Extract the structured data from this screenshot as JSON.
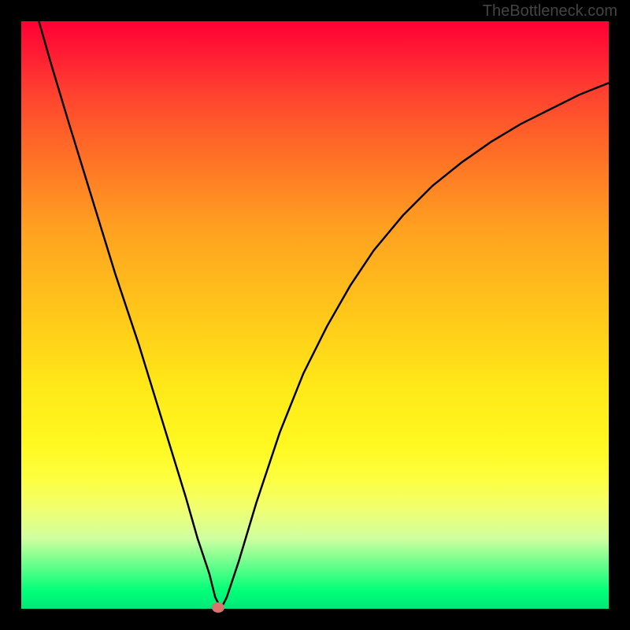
{
  "watermark": "TheBottleneck.com",
  "chart_data": {
    "type": "line",
    "title": "",
    "xlabel": "",
    "ylabel": "",
    "xlim": [
      0,
      100
    ],
    "ylim": [
      0,
      100
    ],
    "series": [
      {
        "name": "curve",
        "x": [
          3,
          5,
          8,
          12,
          16,
          20,
          24,
          28,
          30,
          32,
          33,
          34,
          35,
          37,
          40,
          44,
          48,
          52,
          56,
          60,
          65,
          70,
          75,
          80,
          85,
          90,
          95,
          100
        ],
        "values": [
          100,
          93,
          83,
          70,
          57,
          45,
          32,
          19,
          12,
          6,
          2,
          0,
          2,
          8,
          18,
          30,
          40,
          48,
          55,
          61,
          67,
          72,
          76,
          79.5,
          82.5,
          85,
          87.5,
          89.5
        ]
      }
    ],
    "marker": {
      "x": 33.5,
      "y": 0
    },
    "gradient_colors": {
      "top": "#ff0034",
      "middle": "#ffe818",
      "bottom": "#00e878"
    }
  }
}
